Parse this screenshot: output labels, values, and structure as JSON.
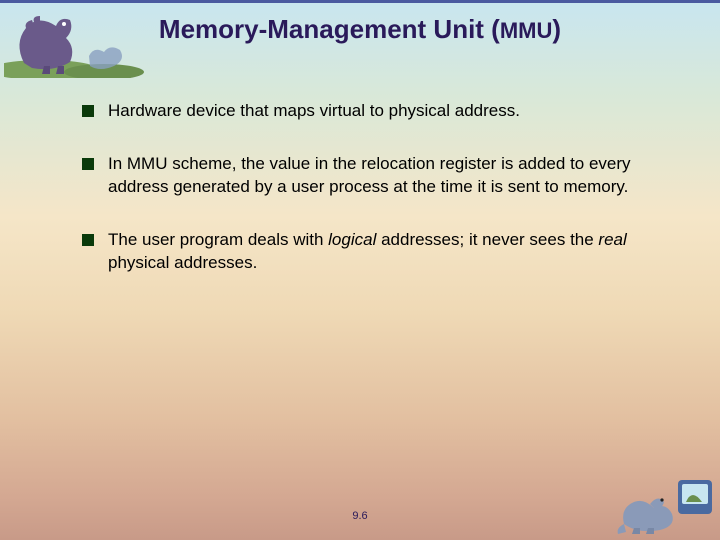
{
  "title_main": "Memory-Management Unit (",
  "title_abbrev": "MMU",
  "title_close": ")",
  "bullets": [
    {
      "html": "Hardware device that maps virtual to physical address."
    },
    {
      "html": "In MMU scheme, the value in the relocation register is added to every address generated by a user process at the time it is sent to memory."
    },
    {
      "html": "The user program deals with <em>logical</em> addresses; it never sees the <em>real</em> physical addresses."
    }
  ],
  "page_number": "9.6"
}
